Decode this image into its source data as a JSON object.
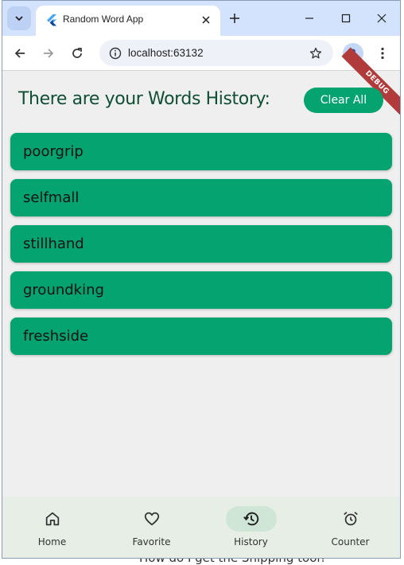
{
  "browser": {
    "tab_title": "Random Word App",
    "url": "localhost:63132"
  },
  "app": {
    "heading": "There are your Words History:",
    "clear_button": "Clear All",
    "debug_label": "DEBUG",
    "words": [
      "poorgrip",
      "selfmall",
      "stillhand",
      "groundking",
      "freshside"
    ]
  },
  "nav": {
    "items": [
      {
        "label": "Home",
        "icon": "home-icon"
      },
      {
        "label": "Favorite",
        "icon": "heart-icon"
      },
      {
        "label": "History",
        "icon": "history-icon",
        "active": true
      },
      {
        "label": "Counter",
        "icon": "alarm-icon"
      }
    ]
  },
  "background_page": {
    "bottom_text": "How do I get the Shipping tool?"
  },
  "colors": {
    "accent": "#05a36f",
    "heading": "#0f4f34",
    "tabstrip": "#d3e3fd",
    "nav_bg": "#e6eee6",
    "nav_active": "#cfe6d7",
    "debug": "#b13a3a"
  }
}
